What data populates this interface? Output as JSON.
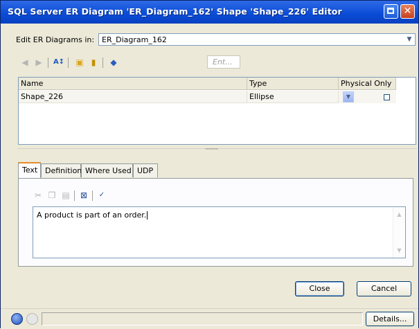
{
  "window": {
    "title": "SQL Server ER Diagram 'ER_Diagram_162' Shape 'Shape_226' Editor",
    "close_glyph": "✕"
  },
  "edit_in": {
    "label": "Edit ER Diagrams in:",
    "value": "ER_Diagram_162"
  },
  "toolbar": {
    "filter_placeholder": "Ent..."
  },
  "grid": {
    "columns": [
      "Name",
      "Type",
      "Physical Only"
    ],
    "rows": [
      {
        "name": "Shape_226",
        "type": "Ellipse",
        "physical_only": false
      }
    ]
  },
  "tabs": [
    "Text",
    "Definition",
    "Where Used",
    "UDP"
  ],
  "active_tab": "Text",
  "text_panel": {
    "content": "A product is part of an order."
  },
  "buttons": {
    "close": "Close",
    "cancel": "Cancel",
    "details": "Details..."
  },
  "colors": {
    "title_bar": "#0a4bd6",
    "active_tab_accent": "#e68b2c",
    "dialog_background": "#ece9d8"
  }
}
